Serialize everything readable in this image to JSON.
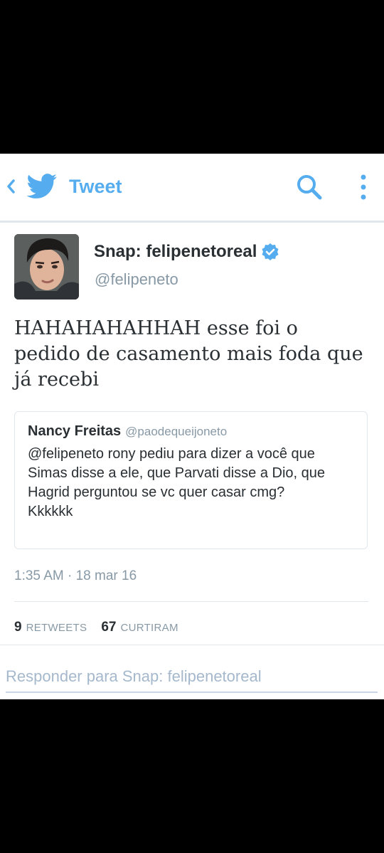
{
  "header": {
    "title": "Tweet",
    "accent_color": "#55acee",
    "icons": [
      "back-chevron-icon",
      "twitter-bird-icon",
      "search-icon",
      "more-vertical-icon"
    ]
  },
  "tweet": {
    "author_name": "Snap: felipenetoreal",
    "author_handle": "@felipeneto",
    "verified": true,
    "text": "HAHAHAHAHHAH esse foi o pedido de casamento mais foda que já recebi",
    "timestamp": "1:35 AM · 18 mar 16"
  },
  "quoted_tweet": {
    "author_name": "Nancy Freitas",
    "author_handle": "@paodequeijoneto",
    "text": "@felipeneto rony pediu para dizer a você que Simas disse a ele, que Parvati disse a Dio, que Hagrid perguntou se vc quer casar cmg?\nKkkkkk"
  },
  "stats": {
    "retweets_count": "9",
    "retweets_label": "RETWEETS",
    "likes_count": "67",
    "likes_label": "CURTIRAM"
  },
  "reply": {
    "placeholder": "Responder para Snap: felipenetoreal"
  }
}
